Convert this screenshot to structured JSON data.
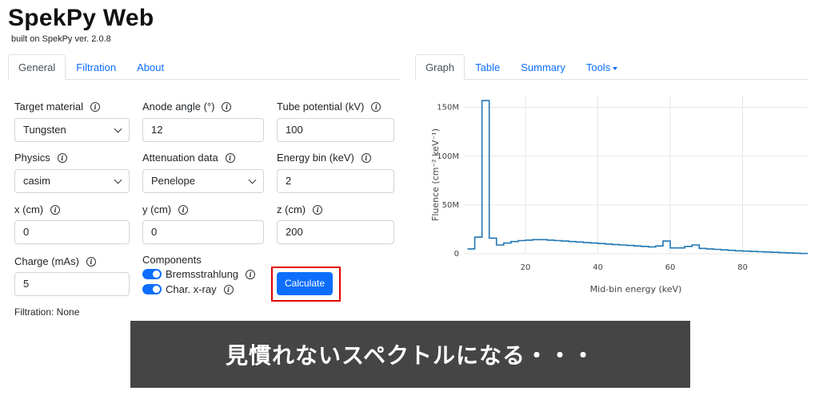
{
  "header": {
    "title": "SpekPy Web",
    "subtitle": "built on SpekPy ver. 2.0.8"
  },
  "left_tabs": [
    {
      "label": "General",
      "active": true
    },
    {
      "label": "Filtration",
      "active": false
    },
    {
      "label": "About",
      "active": false
    }
  ],
  "right_tabs": [
    {
      "label": "Graph",
      "active": true
    },
    {
      "label": "Table",
      "active": false
    },
    {
      "label": "Summary",
      "active": false
    },
    {
      "label": "Tools",
      "active": false,
      "dropdown": true
    }
  ],
  "form": {
    "target_material": {
      "label": "Target material",
      "value": "Tungsten"
    },
    "anode_angle": {
      "label": "Anode angle (°)",
      "value": "12"
    },
    "tube_potential": {
      "label": "Tube potential (kV)",
      "value": "100"
    },
    "physics": {
      "label": "Physics",
      "value": "casim"
    },
    "attenuation": {
      "label": "Attenuation data",
      "value": "Penelope"
    },
    "energy_bin": {
      "label": "Energy bin (keV)",
      "value": "2"
    },
    "x": {
      "label": "x (cm)",
      "value": "0"
    },
    "y": {
      "label": "y (cm)",
      "value": "0"
    },
    "z": {
      "label": "z (cm)",
      "value": "200"
    },
    "charge": {
      "label": "Charge (mAs)",
      "value": "5"
    },
    "components": {
      "label": "Components",
      "bremsstrahlung": {
        "label": "Bremsstrahlung",
        "on": true
      },
      "char_xray": {
        "label": "Char. x-ray",
        "on": true
      }
    },
    "calculate_label": "Calculate",
    "filtration_text": "Filtration: None",
    "info_glyph": "i"
  },
  "overlay_text": "見慣れないスペクトルになる・・・",
  "colors": {
    "accent": "#0d6efd",
    "highlight": "#e00000",
    "overlay_bg": "#454545",
    "line": "#1f77b4"
  },
  "chart_data": {
    "type": "line",
    "step": true,
    "xlabel": "Mid-bin energy (keV)",
    "ylabel": "Fluence (cm⁻² keV⁻¹)",
    "xlim": [
      3,
      98
    ],
    "ylim": [
      0,
      162000000
    ],
    "x_ticks": [
      20,
      40,
      60,
      80
    ],
    "y_ticks": [
      {
        "value": 0,
        "label": "0"
      },
      {
        "value": 50000000,
        "label": "50M"
      },
      {
        "value": 100000000,
        "label": "100M"
      },
      {
        "value": 150000000,
        "label": "150M"
      }
    ],
    "grid": true,
    "series": [
      {
        "x": [
          5,
          7,
          9,
          11,
          13,
          15,
          17,
          19,
          21,
          23,
          25,
          27,
          29,
          31,
          33,
          35,
          37,
          39,
          41,
          43,
          45,
          47,
          49,
          51,
          53,
          55,
          57,
          59,
          61,
          63,
          65,
          67,
          69,
          71,
          73,
          75,
          77,
          79,
          81,
          83,
          85,
          87,
          89,
          91,
          93,
          95,
          97
        ],
        "values": [
          5000000,
          17000000,
          157000000,
          16000000,
          9000000,
          11000000,
          12500000,
          13500000,
          14000000,
          14500000,
          14500000,
          14000000,
          13500000,
          13000000,
          12500000,
          12000000,
          11500000,
          11000000,
          10500000,
          10000000,
          9500000,
          9000000,
          8500000,
          8000000,
          7500000,
          7000000,
          8000000,
          13000000,
          6000000,
          6000000,
          7500000,
          9000000,
          5500000,
          5000000,
          4500000,
          4000000,
          3500000,
          3000000,
          2700000,
          2400000,
          2100000,
          1800000,
          1500000,
          1200000,
          900000,
          600000,
          300000
        ]
      }
    ]
  }
}
